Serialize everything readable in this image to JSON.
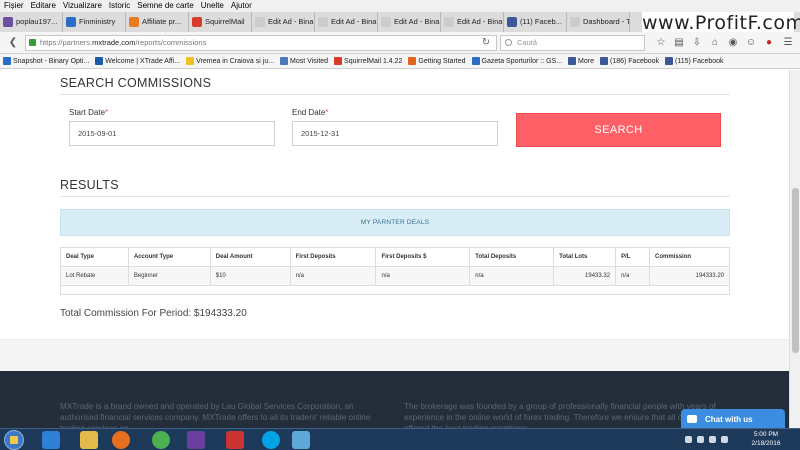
{
  "menubar": [
    "Fișier",
    "Editare",
    "Vizualizare",
    "Istoric",
    "Semne de carte",
    "Unelte",
    "Ajutor"
  ],
  "tabs": [
    {
      "label": "poplau197...",
      "color": "#6b4fa0"
    },
    {
      "label": "Finministry",
      "color": "#2a6cc6"
    },
    {
      "label": "Affiliate pr...",
      "color": "#e87a20"
    },
    {
      "label": "SquirrelMail",
      "color": "#d73b2a"
    },
    {
      "label": "Edit Ad - Binary...",
      "color": "#cccccc"
    },
    {
      "label": "Edit Ad - Binary...",
      "color": "#cccccc"
    },
    {
      "label": "Edit Ad - Binary...",
      "color": "#cccccc"
    },
    {
      "label": "Edit Ad - Binary...",
      "color": "#cccccc"
    },
    {
      "label": "(11) Faceb...",
      "color": "#3b5998"
    },
    {
      "label": "Dashboard - T...",
      "color": "#cccccc"
    }
  ],
  "watermark": "www.ProfitF.com",
  "address": {
    "prefix": "https://partners.",
    "host": "mxtrade.com",
    "path": "/reports/commissions"
  },
  "search_placeholder": "Caută",
  "bookmarks": [
    {
      "label": "Snapshot - Binary Opti...",
      "color": "#2a6cc6"
    },
    {
      "label": "Welcome | XTrade Affi...",
      "color": "#1a5ca8"
    },
    {
      "label": "Vremea in Craiova si ju...",
      "color": "#f0c020"
    },
    {
      "label": "Most Visited",
      "color": "#4a78b8"
    },
    {
      "label": "SquirrelMail 1.4.22",
      "color": "#d73b2a"
    },
    {
      "label": "Getting Started",
      "color": "#e0661e"
    },
    {
      "label": "Gazeta Sporturilor :: GS...",
      "color": "#2a6cc6"
    },
    {
      "label": "More",
      "color": "#3b5998"
    },
    {
      "label": "(186) Facebook",
      "color": "#3b5998"
    },
    {
      "label": "(115) Facebook",
      "color": "#3b5998"
    }
  ],
  "search_section": {
    "title": "SEARCH COMMISSIONS",
    "start_label": "Start Date",
    "start_value": "2015-09-01",
    "end_label": "End Date",
    "end_value": "2015-12-31",
    "required_mark": "*",
    "button": "SEARCH"
  },
  "results": {
    "title": "RESULTS",
    "banner": "MY PARNTER DEALS",
    "columns": [
      "Deal Type",
      "Account Type",
      "Deal Amount",
      "First Deposits",
      "First Deposits $",
      "Total Deposits",
      "Total Lots",
      "P/L",
      "Commission"
    ],
    "rows": [
      [
        "Lot Rebate",
        "Beginner",
        "$10",
        "n/a",
        "n/a",
        "n/a",
        "19433.32",
        "n/a",
        "194333.20"
      ]
    ],
    "total": "Total Commission For Period: $194333.20"
  },
  "footer": {
    "left": "MXTrade is a brand owned and operated by Lau Global Services Corporation, an authorised financial services company. MXTrade offers to all its traders' reliable online trading services on ...",
    "right": "The brokerage was founded by a group of professionally financial people with years of experience in the online world of forex trading. Therefore we ensure that all our traders are offered the best trading conditions ..."
  },
  "chat_label": "Chat with us",
  "clock": {
    "time": "5:00 PM",
    "date": "2/18/2016"
  }
}
